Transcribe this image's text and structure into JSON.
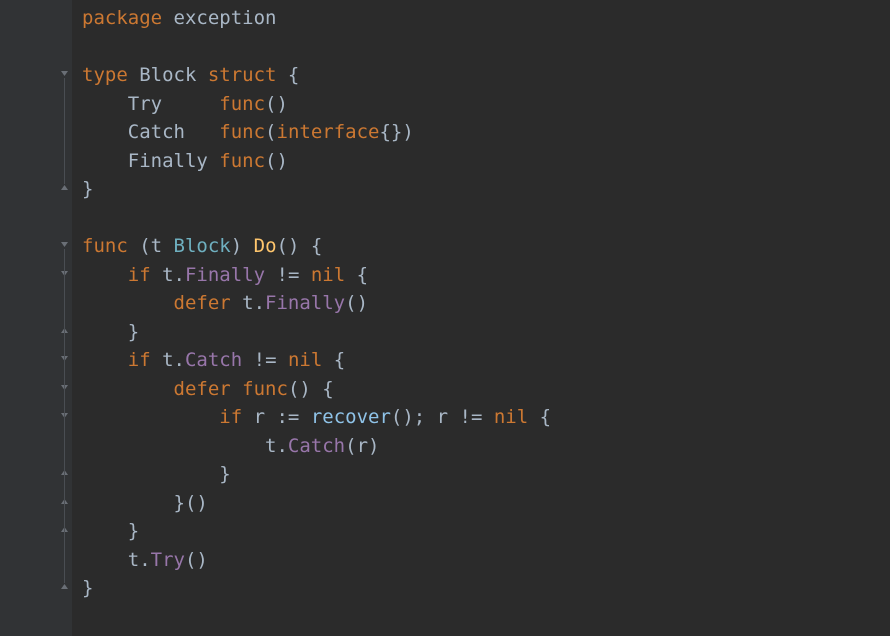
{
  "code": {
    "lines": [
      {
        "indent": 0,
        "tokens": [
          {
            "cls": "kw",
            "t": "package"
          },
          {
            "cls": "ident",
            "t": " exception"
          }
        ]
      },
      {
        "indent": 0,
        "tokens": []
      },
      {
        "indent": 0,
        "tokens": [
          {
            "cls": "kw",
            "t": "type"
          },
          {
            "cls": "ident",
            "t": " Block "
          },
          {
            "cls": "kw",
            "t": "struct"
          },
          {
            "cls": "ident",
            "t": " {"
          }
        ]
      },
      {
        "indent": 1,
        "tokens": [
          {
            "cls": "ident",
            "t": "Try     "
          },
          {
            "cls": "kw",
            "t": "func"
          },
          {
            "cls": "ident",
            "t": "()"
          }
        ]
      },
      {
        "indent": 1,
        "tokens": [
          {
            "cls": "ident",
            "t": "Catch   "
          },
          {
            "cls": "kw",
            "t": "func"
          },
          {
            "cls": "ident",
            "t": "("
          },
          {
            "cls": "kw",
            "t": "interface"
          },
          {
            "cls": "ident",
            "t": "{})"
          }
        ]
      },
      {
        "indent": 1,
        "tokens": [
          {
            "cls": "ident",
            "t": "Finally "
          },
          {
            "cls": "kw",
            "t": "func"
          },
          {
            "cls": "ident",
            "t": "()"
          }
        ]
      },
      {
        "indent": 0,
        "tokens": [
          {
            "cls": "ident",
            "t": "}"
          }
        ]
      },
      {
        "indent": 0,
        "tokens": []
      },
      {
        "indent": 0,
        "tokens": [
          {
            "cls": "kw",
            "t": "func"
          },
          {
            "cls": "ident",
            "t": " (t "
          },
          {
            "cls": "type",
            "t": "Block"
          },
          {
            "cls": "ident",
            "t": ") "
          },
          {
            "cls": "funcname",
            "t": "Do"
          },
          {
            "cls": "ident",
            "t": "() {"
          }
        ]
      },
      {
        "indent": 1,
        "tokens": [
          {
            "cls": "kw",
            "t": "if"
          },
          {
            "cls": "ident",
            "t": " t."
          },
          {
            "cls": "field",
            "t": "Finally"
          },
          {
            "cls": "ident",
            "t": " != "
          },
          {
            "cls": "kw",
            "t": "nil"
          },
          {
            "cls": "ident",
            "t": " {"
          }
        ]
      },
      {
        "indent": 2,
        "tokens": [
          {
            "cls": "kw",
            "t": "defer"
          },
          {
            "cls": "ident",
            "t": " t."
          },
          {
            "cls": "field",
            "t": "Finally"
          },
          {
            "cls": "ident",
            "t": "()"
          }
        ]
      },
      {
        "indent": 1,
        "tokens": [
          {
            "cls": "ident",
            "t": "}"
          }
        ]
      },
      {
        "indent": 1,
        "tokens": [
          {
            "cls": "kw",
            "t": "if"
          },
          {
            "cls": "ident",
            "t": " t."
          },
          {
            "cls": "field",
            "t": "Catch"
          },
          {
            "cls": "ident",
            "t": " != "
          },
          {
            "cls": "kw",
            "t": "nil"
          },
          {
            "cls": "ident",
            "t": " {"
          }
        ]
      },
      {
        "indent": 2,
        "tokens": [
          {
            "cls": "kw",
            "t": "defer"
          },
          {
            "cls": "ident",
            "t": " "
          },
          {
            "cls": "kw",
            "t": "func"
          },
          {
            "cls": "ident",
            "t": "() {"
          }
        ]
      },
      {
        "indent": 3,
        "tokens": [
          {
            "cls": "kw",
            "t": "if"
          },
          {
            "cls": "ident",
            "t": " r := "
          },
          {
            "cls": "builtin",
            "t": "recover"
          },
          {
            "cls": "ident",
            "t": "(); r != "
          },
          {
            "cls": "kw",
            "t": "nil"
          },
          {
            "cls": "ident",
            "t": " {"
          }
        ]
      },
      {
        "indent": 4,
        "tokens": [
          {
            "cls": "ident",
            "t": "t."
          },
          {
            "cls": "field",
            "t": "Catch"
          },
          {
            "cls": "ident",
            "t": "(r)"
          }
        ]
      },
      {
        "indent": 3,
        "tokens": [
          {
            "cls": "ident",
            "t": "}"
          }
        ]
      },
      {
        "indent": 2,
        "tokens": [
          {
            "cls": "ident",
            "t": "}()"
          }
        ]
      },
      {
        "indent": 1,
        "tokens": [
          {
            "cls": "ident",
            "t": "}"
          }
        ]
      },
      {
        "indent": 1,
        "tokens": [
          {
            "cls": "ident",
            "t": "t."
          },
          {
            "cls": "field",
            "t": "Try"
          },
          {
            "cls": "ident",
            "t": "()"
          }
        ]
      },
      {
        "indent": 0,
        "tokens": [
          {
            "cls": "ident",
            "t": "}"
          }
        ]
      }
    ],
    "fold_marks": [
      {
        "line": 2,
        "type": "open"
      },
      {
        "line": 6,
        "type": "close"
      },
      {
        "line": 8,
        "type": "open"
      },
      {
        "line": 9,
        "type": "open"
      },
      {
        "line": 11,
        "type": "close"
      },
      {
        "line": 12,
        "type": "open"
      },
      {
        "line": 13,
        "type": "open"
      },
      {
        "line": 14,
        "type": "open"
      },
      {
        "line": 16,
        "type": "close"
      },
      {
        "line": 17,
        "type": "close"
      },
      {
        "line": 18,
        "type": "close"
      },
      {
        "line": 20,
        "type": "close"
      }
    ]
  },
  "colors": {
    "background": "#2b2b2b",
    "gutter": "#313335",
    "keyword": "#cc7832",
    "identifier": "#a9b7c6",
    "type": "#6fb0c0",
    "function_name": "#ffc66d",
    "field": "#9876aa",
    "builtin": "#8fc3e8"
  }
}
